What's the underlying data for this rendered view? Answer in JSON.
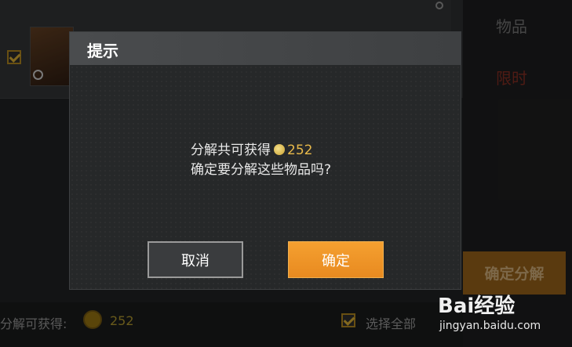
{
  "background": {
    "tabs": [
      "物品",
      "限时"
    ],
    "decompose_button": "确定分解",
    "bottom": {
      "label": "分解可获得:",
      "value": "252",
      "select_all": "选择全部"
    }
  },
  "dialog": {
    "title": "提示",
    "line1_prefix": "分解共可获得",
    "amount": "252",
    "line2": "确定要分解这些物品吗?",
    "cancel_label": "取消",
    "confirm_label": "确定"
  },
  "watermark": {
    "text": "Bai经验",
    "url": "jingyan.baidu.com"
  }
}
